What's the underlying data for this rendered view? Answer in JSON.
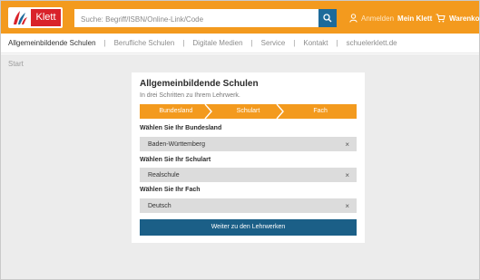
{
  "header": {
    "logo_text": "Klett",
    "search": {
      "placeholder": "Suche: Begriff/ISBN/Online-Link/Code",
      "value": ""
    },
    "login": {
      "prefix": "Anmelden",
      "name": "Mein Klett"
    },
    "cart_label": "Warenkorb",
    "colors": {
      "bar": "#f39a1e",
      "search_button": "#1d6a9a",
      "logo_badge": "#d9222a"
    }
  },
  "nav": {
    "items": [
      "Allgemeinbildende Schulen",
      "Berufliche Schulen",
      "Digitale Medien",
      "Service",
      "Kontakt",
      "schuelerklett.de"
    ]
  },
  "breadcrumb": "Start",
  "wizard": {
    "title": "Allgemeinbildende Schulen",
    "subtitle": "In drei Schritten zu Ihrem Lehrwerk.",
    "steps": [
      "Bundesland",
      "Schulart",
      "Fach"
    ],
    "fields": [
      {
        "label": "Wählen Sie Ihr Bundesland",
        "value": "Baden-Württemberg"
      },
      {
        "label": "Wählen Sie Ihr Schulart",
        "value": "Realschule"
      },
      {
        "label": "Wählen Sie Ihr Fach",
        "value": "Deutsch"
      }
    ],
    "clear_symbol": "×",
    "submit_label": "Weiter zu den Lehrwerken",
    "colors": {
      "steps": "#f39a1e",
      "button": "#1b5f87",
      "field_bg": "#dcdcdc"
    }
  }
}
